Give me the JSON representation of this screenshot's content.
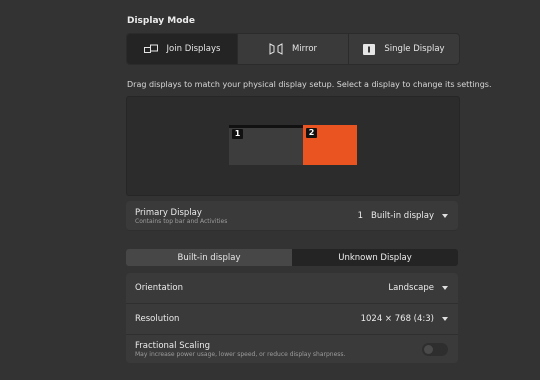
{
  "display_mode": {
    "title": "Display Mode",
    "options": [
      {
        "label": "Join Displays",
        "icon": "join-displays-icon",
        "selected": true
      },
      {
        "label": "Mirror",
        "icon": "mirror-icon",
        "selected": false
      },
      {
        "label": "Single Display",
        "icon": "single-display-icon",
        "selected": false
      }
    ]
  },
  "hint": "Drag displays to match your physical display setup. Select a display to change its settings.",
  "arrangement": {
    "displays": [
      {
        "number": "1",
        "color": "#3d3d3d"
      },
      {
        "number": "2",
        "color": "#e95420"
      }
    ]
  },
  "primary_display": {
    "label": "Primary Display",
    "sublabel": "Contains top bar and Activities",
    "value_number": "1",
    "value_name": "Built-in display"
  },
  "display_tabs": [
    {
      "label": "Built-in display",
      "selected": false
    },
    {
      "label": "Unknown Display",
      "selected": true
    }
  ],
  "settings": {
    "orientation": {
      "label": "Orientation",
      "value": "Landscape"
    },
    "resolution": {
      "label": "Resolution",
      "value": "1024 × 768 (4:3)"
    },
    "fractional_scaling": {
      "label": "Fractional Scaling",
      "sublabel": "May increase power usage, lower speed, or reduce display sharpness.",
      "enabled": false
    }
  },
  "colors": {
    "accent": "#e95420",
    "background": "#333333",
    "panel": "#3a3a3a"
  }
}
